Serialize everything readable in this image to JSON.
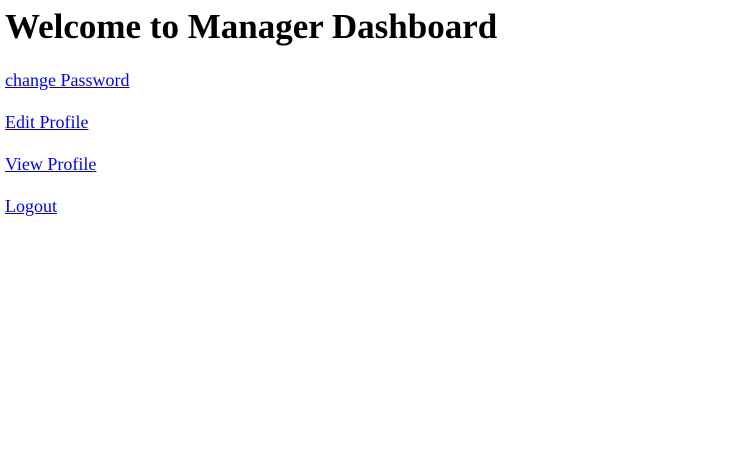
{
  "page": {
    "heading": "Welcome to Manager Dashboard"
  },
  "links": [
    {
      "label": "change Password"
    },
    {
      "label": "Edit Profile"
    },
    {
      "label": "View Profile"
    },
    {
      "label": "Logout"
    }
  ],
  "colors": {
    "link": "#0000ee",
    "text": "#000000",
    "background": "#ffffff"
  }
}
